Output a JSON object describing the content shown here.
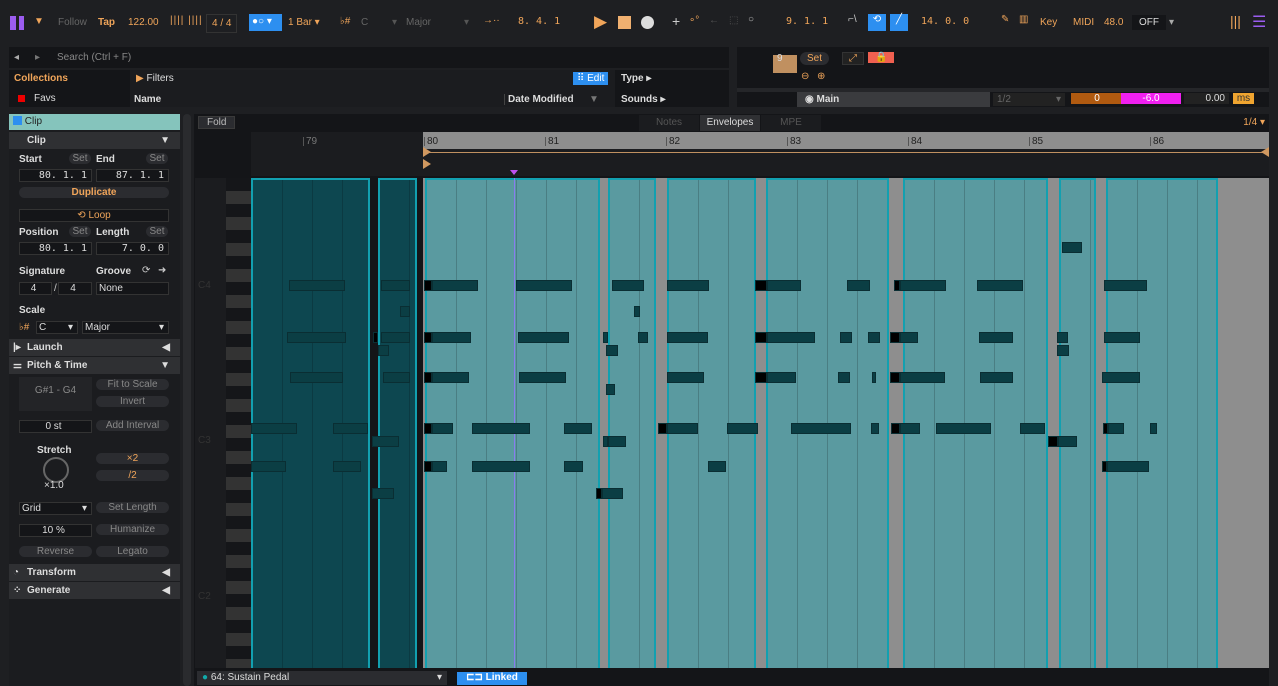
{
  "transport": {
    "follow": "Follow",
    "tap": "Tap",
    "tempo": "122.00",
    "signature": "4 / 4",
    "quantize": "1 Bar",
    "root": "C",
    "scale": "Major",
    "arrangement_position": "8.  4.  1",
    "loop_start": "9.  1.  1",
    "loop_length": "14.  0.  0",
    "key_label": "Key",
    "midi_label": "MIDI",
    "cpu": "48.0",
    "off": "OFF"
  },
  "browser": {
    "search_placeholder": "Search (Ctrl + F)",
    "collections": "Collections",
    "favs": "Favs",
    "filters": "Filters",
    "edit": "Edit",
    "col_name": "Name",
    "col_date": "Date Modified",
    "type": "Type",
    "sounds": "Sounds"
  },
  "mixer": {
    "bar": "9",
    "set": "Set",
    "track": "Main",
    "input": "1/2",
    "value": "0",
    "volume": "-6.0",
    "delay": "0.00",
    "unit": "ms"
  },
  "clip": {
    "title": "Clip",
    "section": "Clip",
    "start_label": "Start",
    "end_label": "End",
    "set": "Set",
    "start": "80.  1.  1",
    "end": "87.  1.  1",
    "duplicate": "Duplicate",
    "loop": "Loop",
    "position_label": "Position",
    "length_label": "Length",
    "position": "80.  1.  1",
    "length": "7.  0.  0",
    "signature_label": "Signature",
    "groove_label": "Groove",
    "sig_num": "4",
    "sig_den": "4",
    "groove": "None",
    "scale_label": "Scale",
    "root": "C",
    "scale": "Major"
  },
  "launch": "Launch",
  "pitch": {
    "title": "Pitch & Time",
    "range": "G#1 - G4",
    "fit": "Fit to Scale",
    "invert": "Invert",
    "transpose": "0 st",
    "add_interval": "Add Interval",
    "stretch": "Stretch",
    "stretch_val": "×1.0",
    "x2": "×2",
    "half": "/2",
    "grid": "Grid",
    "set_length": "Set Length",
    "humanize_val": "10 %",
    "humanize": "Humanize",
    "reverse": "Reverse",
    "legato": "Legato"
  },
  "transform": "Transform",
  "generate": "Generate",
  "editor": {
    "fold": "Fold",
    "tabs": [
      "Notes",
      "Envelopes",
      "MPE"
    ],
    "grid": "1/4",
    "bars": [
      "79",
      "80",
      "81",
      "82",
      "83",
      "84",
      "85",
      "86"
    ],
    "keys": [
      "C4",
      "C3",
      "C2"
    ],
    "envelope": "64: Sustain Pedal",
    "linked": "Linked"
  },
  "colors": {
    "accent": "#f0a55a",
    "clip": "#85c4bc",
    "selected": "#2d8ff0"
  }
}
